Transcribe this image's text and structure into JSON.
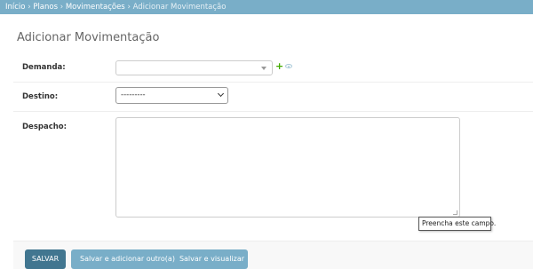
{
  "breadcrumbs": {
    "home": "Início",
    "plans": "Planos",
    "movements": "Movimentações",
    "current": "Adicionar Movimentação",
    "separator": "›"
  },
  "page_title": "Adicionar Movimentação",
  "form": {
    "demanda": {
      "label": "Demanda:",
      "value": ""
    },
    "destino": {
      "label": "Destino:",
      "value": "---------"
    },
    "despacho": {
      "label": "Despacho:",
      "value": ""
    }
  },
  "tooltip": "Preencha este campo.",
  "buttons": {
    "save": "SALVAR",
    "save_add": "Salvar e adicionar outro(a)",
    "save_view": "Salvar e visualizar"
  },
  "colors": {
    "header": "#79aec8",
    "primary_button": "#417690",
    "secondary_button": "#79aec8",
    "add_icon": "#44aa00"
  },
  "icons": {
    "add": "plus-icon",
    "view": "eye-icon"
  }
}
